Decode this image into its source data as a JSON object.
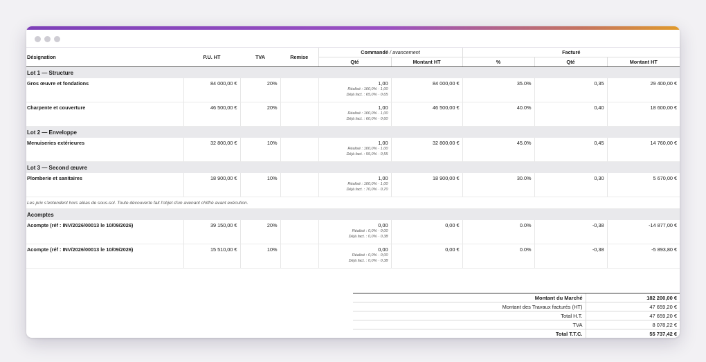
{
  "table": {
    "headers": {
      "designation": "Désignation",
      "pu_ht": "P.U. HT",
      "tva": "TVA",
      "remise": "Remise",
      "commande": "Commandé",
      "avancement": "/ avancement",
      "facture": "Facturé",
      "qte": "Qté",
      "montant_ht": "Montant HT",
      "pct": "%",
      "qte2": "Qté",
      "montant_ht2": "Montant HT"
    },
    "lots": [
      {
        "title": "Lot 1 — Structure",
        "items": [
          {
            "designation": "Gros œuvre et fondations",
            "pu_ht": "84 000,00 €",
            "tva": "20%",
            "remise": "",
            "qte": "1,00",
            "realise": "Réalisé : 100,0% · 1,00",
            "deja": "Déjà fact. : 65,0% · 0,65",
            "montant_ht": "84 000,00 €",
            "pct": "35.0%",
            "qte_fact": "0,35",
            "montant_fact": "29 400,00 €"
          },
          {
            "designation": "Charpente et couverture",
            "pu_ht": "46 500,00 €",
            "tva": "20%",
            "remise": "",
            "qte": "1,00",
            "realise": "Réalisé : 100,0% · 1,00",
            "deja": "Déjà fact. : 60,0% · 0,60",
            "montant_ht": "46 500,00 €",
            "pct": "40.0%",
            "qte_fact": "0,40",
            "montant_fact": "18 600,00 €"
          }
        ]
      },
      {
        "title": "Lot 2 — Enveloppe",
        "items": [
          {
            "designation": "Menuiseries extérieures",
            "pu_ht": "32 800,00 €",
            "tva": "10%",
            "remise": "",
            "qte": "1,00",
            "realise": "Réalisé : 100,0% · 1,00",
            "deja": "Déjà fact. : 55,0% · 0,55",
            "montant_ht": "32 800,00 €",
            "pct": "45.0%",
            "qte_fact": "0,45",
            "montant_fact": "14 760,00 €"
          }
        ]
      },
      {
        "title": "Lot 3 — Second œuvre",
        "items": [
          {
            "designation": "Plomberie et sanitaires",
            "pu_ht": "18 900,00 €",
            "tva": "10%",
            "remise": "",
            "qte": "1,00",
            "realise": "Réalisé : 100,0% · 1,00",
            "deja": "Déjà fact. : 70,0% · 0,70",
            "montant_ht": "18 900,00 €",
            "pct": "30.0%",
            "qte_fact": "0,30",
            "montant_fact": "5 670,00 €"
          }
        ]
      }
    ],
    "note": "Les prix s'entendent hors aléas de sous-sol. Toute découverte fait l'objet d'un avenant chiffré avant exécution.",
    "acomptes": {
      "title": "Acomptes",
      "items": [
        {
          "designation": "Acompte (réf : INV/2026/00013 le 10/09/2026)",
          "pu_ht": "39 150,00 €",
          "tva": "20%",
          "remise": "",
          "qte": "0,00",
          "realise": "Réalisé : 0,0% · 0,00",
          "deja": "Déjà fact. : 0,0% · 0,38",
          "montant_ht": "0,00 €",
          "pct": "0.0%",
          "qte_fact": "-0,38",
          "montant_fact": "-14 877,00 €"
        },
        {
          "designation": "Acompte (réf : INV/2026/00013 le 10/09/2026)",
          "pu_ht": "15 510,00 €",
          "tva": "10%",
          "remise": "",
          "qte": "0,00",
          "realise": "Réalisé : 0,0% · 0,00",
          "deja": "Déjà fact. : 0,0% · 0,38",
          "montant_ht": "0,00 €",
          "pct": "0.0%",
          "qte_fact": "-0,38",
          "montant_fact": "-5 893,80 €"
        }
      ]
    }
  },
  "totals": [
    {
      "label": "Montant du Marché",
      "value": "182 200,00 €"
    },
    {
      "label": "Montant des Travaux facturés (HT)",
      "value": "47 659,20 €"
    },
    {
      "label": "Total H.T.",
      "value": "47 659,20 €"
    },
    {
      "label": "TVA",
      "value": "8 078,22 €"
    },
    {
      "label": "Total T.T.C.",
      "value": "55 737,42 €"
    }
  ]
}
